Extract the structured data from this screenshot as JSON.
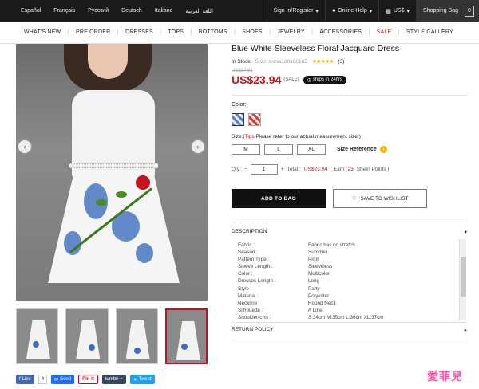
{
  "topbar": {
    "languages": [
      "Español",
      "Français",
      "Русский",
      "Deutsch",
      "Italiano",
      "اللغة العربية"
    ],
    "signin": "Sign In/Register",
    "help": "Online Help",
    "currency": "US$",
    "bag_label": "Shopping Bag",
    "bag_count": "0"
  },
  "nav": [
    "WHAT'S NEW",
    "PRE ORDER",
    "DRESSES",
    "TOPS",
    "BOTTOMS",
    "SHOES",
    "JEWELRY",
    "ACCESSORIES",
    "SALE",
    "STYLE GALLERY"
  ],
  "product": {
    "title": "Blue White Sleeveless Floral Jacquard Dress",
    "stock": "In Stock",
    "sku": "SKU: dress160106165",
    "stars": "★★★★★",
    "reviews": "(3)",
    "original_price": "US$37.81",
    "price": "US$23.94",
    "sale_tag": "(SALE)",
    "ships": "ships in 24hrs",
    "color_label": "Color:",
    "size_label_tips": "(Tips:",
    "size_label_prefix": "Size:",
    "size_label_rest": "Please refer to our actual measurement size.)",
    "sizes": [
      "M",
      "L",
      "XL"
    ],
    "size_reference": "Size Reference",
    "qty_label": "Qty:",
    "qty_minus": "−",
    "qty_value": "1",
    "qty_plus": "+",
    "total_label": "Total :",
    "total_value": "US$23.94",
    "earn_prefix": "( Earn",
    "earn_points": "23",
    "earn_suffix": "SheIn Points )",
    "add_to_bag": "ADD TO BAG",
    "wishlist": "SAVE TO WISHLIST"
  },
  "description": {
    "heading": "DESCRIPTION",
    "rows": [
      {
        "k": "Fabric :",
        "v": "Fabric has no stretch"
      },
      {
        "k": "Season :",
        "v": "Summer"
      },
      {
        "k": "Pattern Type :",
        "v": "Print"
      },
      {
        "k": "Sleeve Length :",
        "v": "Sleeveless"
      },
      {
        "k": "Color :",
        "v": "Multicolor"
      },
      {
        "k": "Dresses Length :",
        "v": "Long"
      },
      {
        "k": "Style :",
        "v": "Party"
      },
      {
        "k": "Material :",
        "v": "Polyester"
      },
      {
        "k": "Neckline :",
        "v": "Round Neck"
      },
      {
        "k": "Silhouette :",
        "v": "A Line"
      },
      {
        "k": "Shoulder(cm) :",
        "v": "S:34cm M:35cm L:36cm XL:37cm"
      }
    ]
  },
  "return_policy": "RETURN POLICY",
  "social": {
    "like": "Like",
    "like_count": "4",
    "send": "Send",
    "pin": "Pin it",
    "tumblr": "tumblr +",
    "tweet": "Tweet"
  },
  "watermark": "愛菲兒",
  "colors": {
    "accent": "#c0161d",
    "topbar": "#1a1a1a"
  }
}
